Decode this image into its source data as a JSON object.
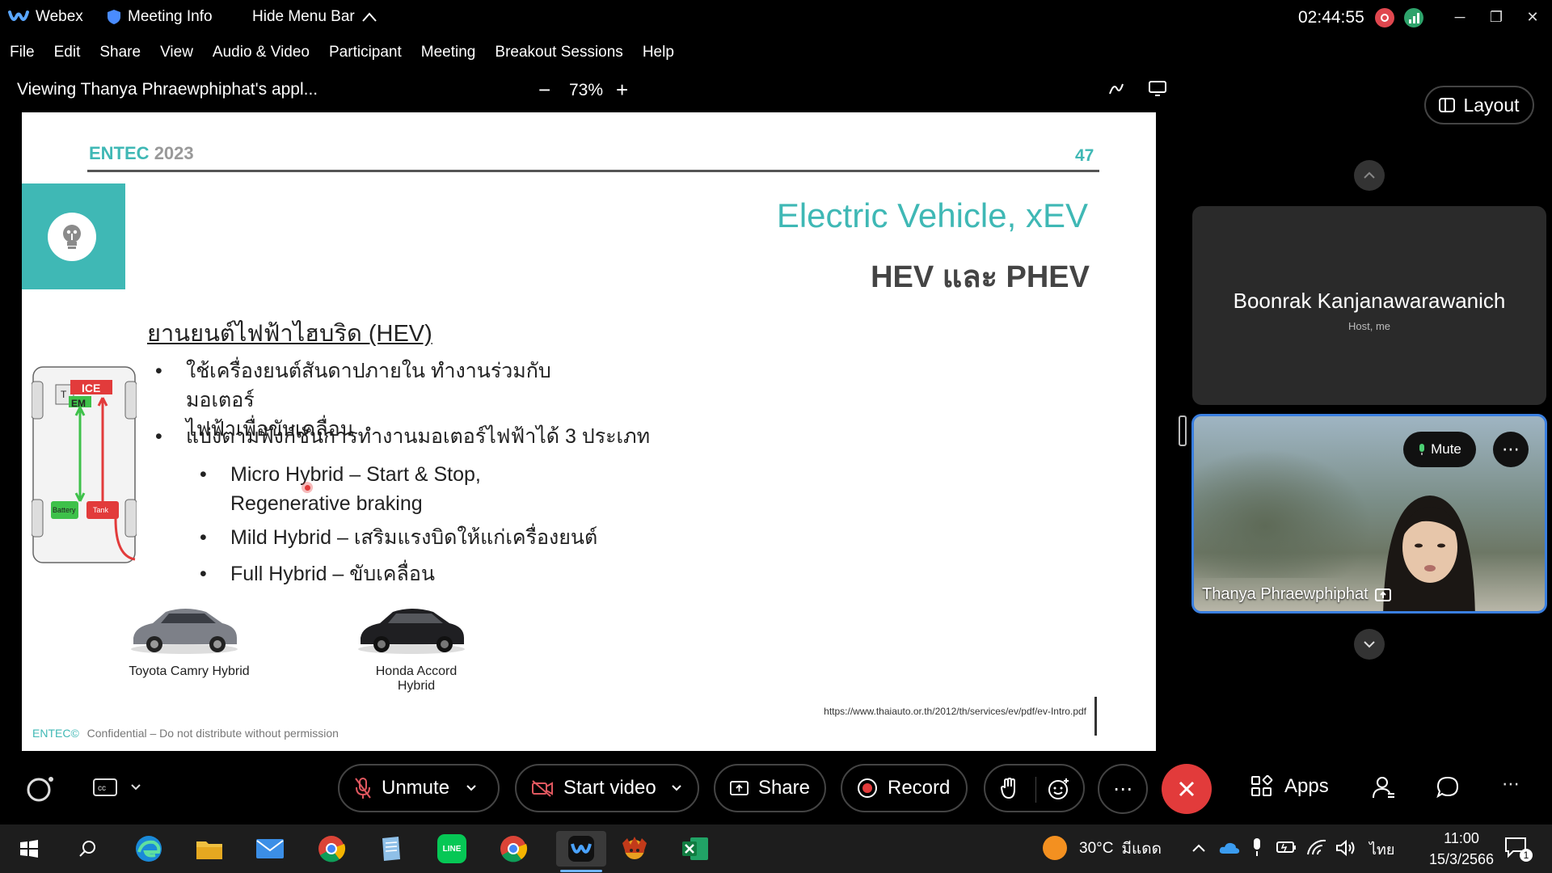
{
  "titlebar": {
    "app_name": "Webex",
    "meeting_info": "Meeting Info",
    "hide_menu": "Hide Menu Bar",
    "clock": "02:44:55"
  },
  "menu": [
    "File",
    "Edit",
    "Share",
    "View",
    "Audio & Video",
    "Participant",
    "Meeting",
    "Breakout Sessions",
    "Help"
  ],
  "share": {
    "viewing": "Viewing Thanya Phraewphiphat's appl...",
    "zoom": "73%"
  },
  "slide": {
    "brand": "ENTEC",
    "year": "2023",
    "page": "47",
    "title": "Electric Vehicle, xEV",
    "subtitle": "HEV และ PHEV",
    "heading": "ยานยนต์ไฟฟ้าไฮบริด (HEV)",
    "bullets": [
      "ใช้เครื่องยนต์สันดาปภายใน ทำงานร่วมกับมอเตอร์ไฟฟ้าเพื่อขับเคลื่อน",
      "แบ่งตามฟังก์ชันการทำงานมอเตอร์ไฟฟ้าได้ 3 ประเภท"
    ],
    "bullet1_line1": "ใช้เครื่องยนต์สันดาปภายใน ทำงานร่วมกับมอเตอร์",
    "bullet1_line2": "ไฟฟ้าเพื่อขับเคลื่อน",
    "sub_bullets": {
      "micro_1": "Micro Hybrid – Start & Stop,",
      "micro_2": "Regenerative braking",
      "mild": "Mild Hybrid – เสริมแรงบิดให้แก่เครื่องยนต์",
      "full": "Full Hybrid – ขับเคลื่อน"
    },
    "diagram": {
      "ice": "ICE",
      "em": "EM",
      "t": "T",
      "battery": "Battery",
      "tank": "Tank"
    },
    "cars": [
      "Toyota Camry Hybrid",
      "Honda Accord Hybrid"
    ],
    "source_url": "https://www.thaiauto.or.th/2012/th/services/ev/pdf/ev-Intro.pdf",
    "footer_brand": "ENTEC©",
    "footer_text": "Confidential – Do not distribute without permission"
  },
  "right_panel": {
    "layout_label": "Layout",
    "host_name": "Boonrak Kanjanawarawanich",
    "host_role": "Host, me",
    "presenter_name": "Thanya Phraewphiphat",
    "mute_label": "Mute"
  },
  "controls": {
    "unmute": "Unmute",
    "start_video": "Start video",
    "share": "Share",
    "record": "Record",
    "apps": "Apps"
  },
  "taskbar": {
    "weather": "30°C",
    "weather_desc": "มีแดด",
    "lang": "ไทย",
    "time": "11:00",
    "date": "15/3/2566",
    "notif_count": "1"
  },
  "colors": {
    "teal": "#3fb8b5",
    "record_red": "#e23b3b",
    "slide_bg": "#ffffff"
  }
}
